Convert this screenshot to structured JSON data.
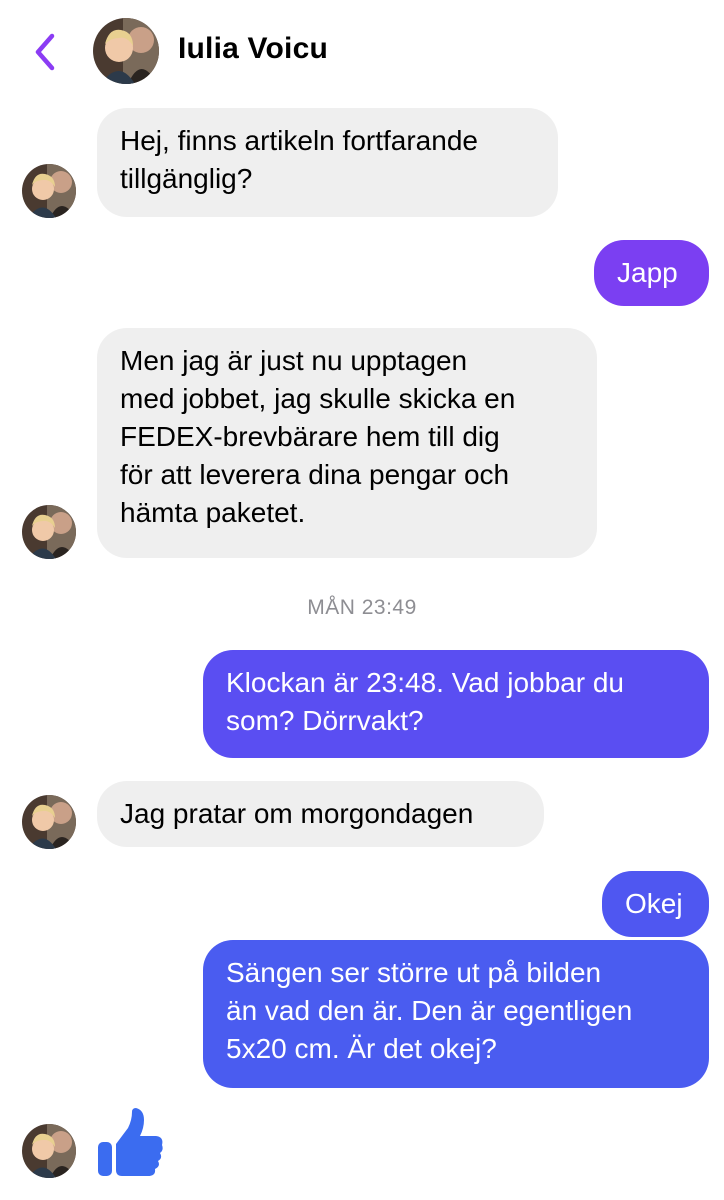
{
  "header": {
    "contact_name": "Iulia Voicu"
  },
  "messages": [
    {
      "side": "in",
      "text": "Hej, finns artikeln fortfarande\ntillgänglig?"
    },
    {
      "side": "out",
      "text": "Japp"
    },
    {
      "side": "in",
      "text": "Men jag är just nu upptagen\nmed jobbet, jag skulle skicka en\nFEDEX-brevbärare hem till dig\nför att leverera dina pengar och\nhämta paketet."
    },
    {
      "side": "out",
      "text": "Klockan är 23:48. Vad jobbar du\nsom? Dörrvakt?"
    },
    {
      "side": "in",
      "text": "Jag pratar om morgondagen"
    },
    {
      "side": "out",
      "text": "Okej"
    },
    {
      "side": "out",
      "text": "Sängen ser större ut på bilden\nän vad den är. Den är egentligen\n5x20 cm. Är det okej?"
    }
  ],
  "timestamp": "MÅN 23:49",
  "reaction": "like-thumbs-up-icon",
  "colors": {
    "accent_purple": "#8b3cf4",
    "bubble_out_1": "#7b3ff2",
    "bubble_out_2": "#5a4ef2",
    "bubble_out_3": "#4a5cf0",
    "bubble_in": "#efefef",
    "thumb": "#3b6cf0"
  }
}
